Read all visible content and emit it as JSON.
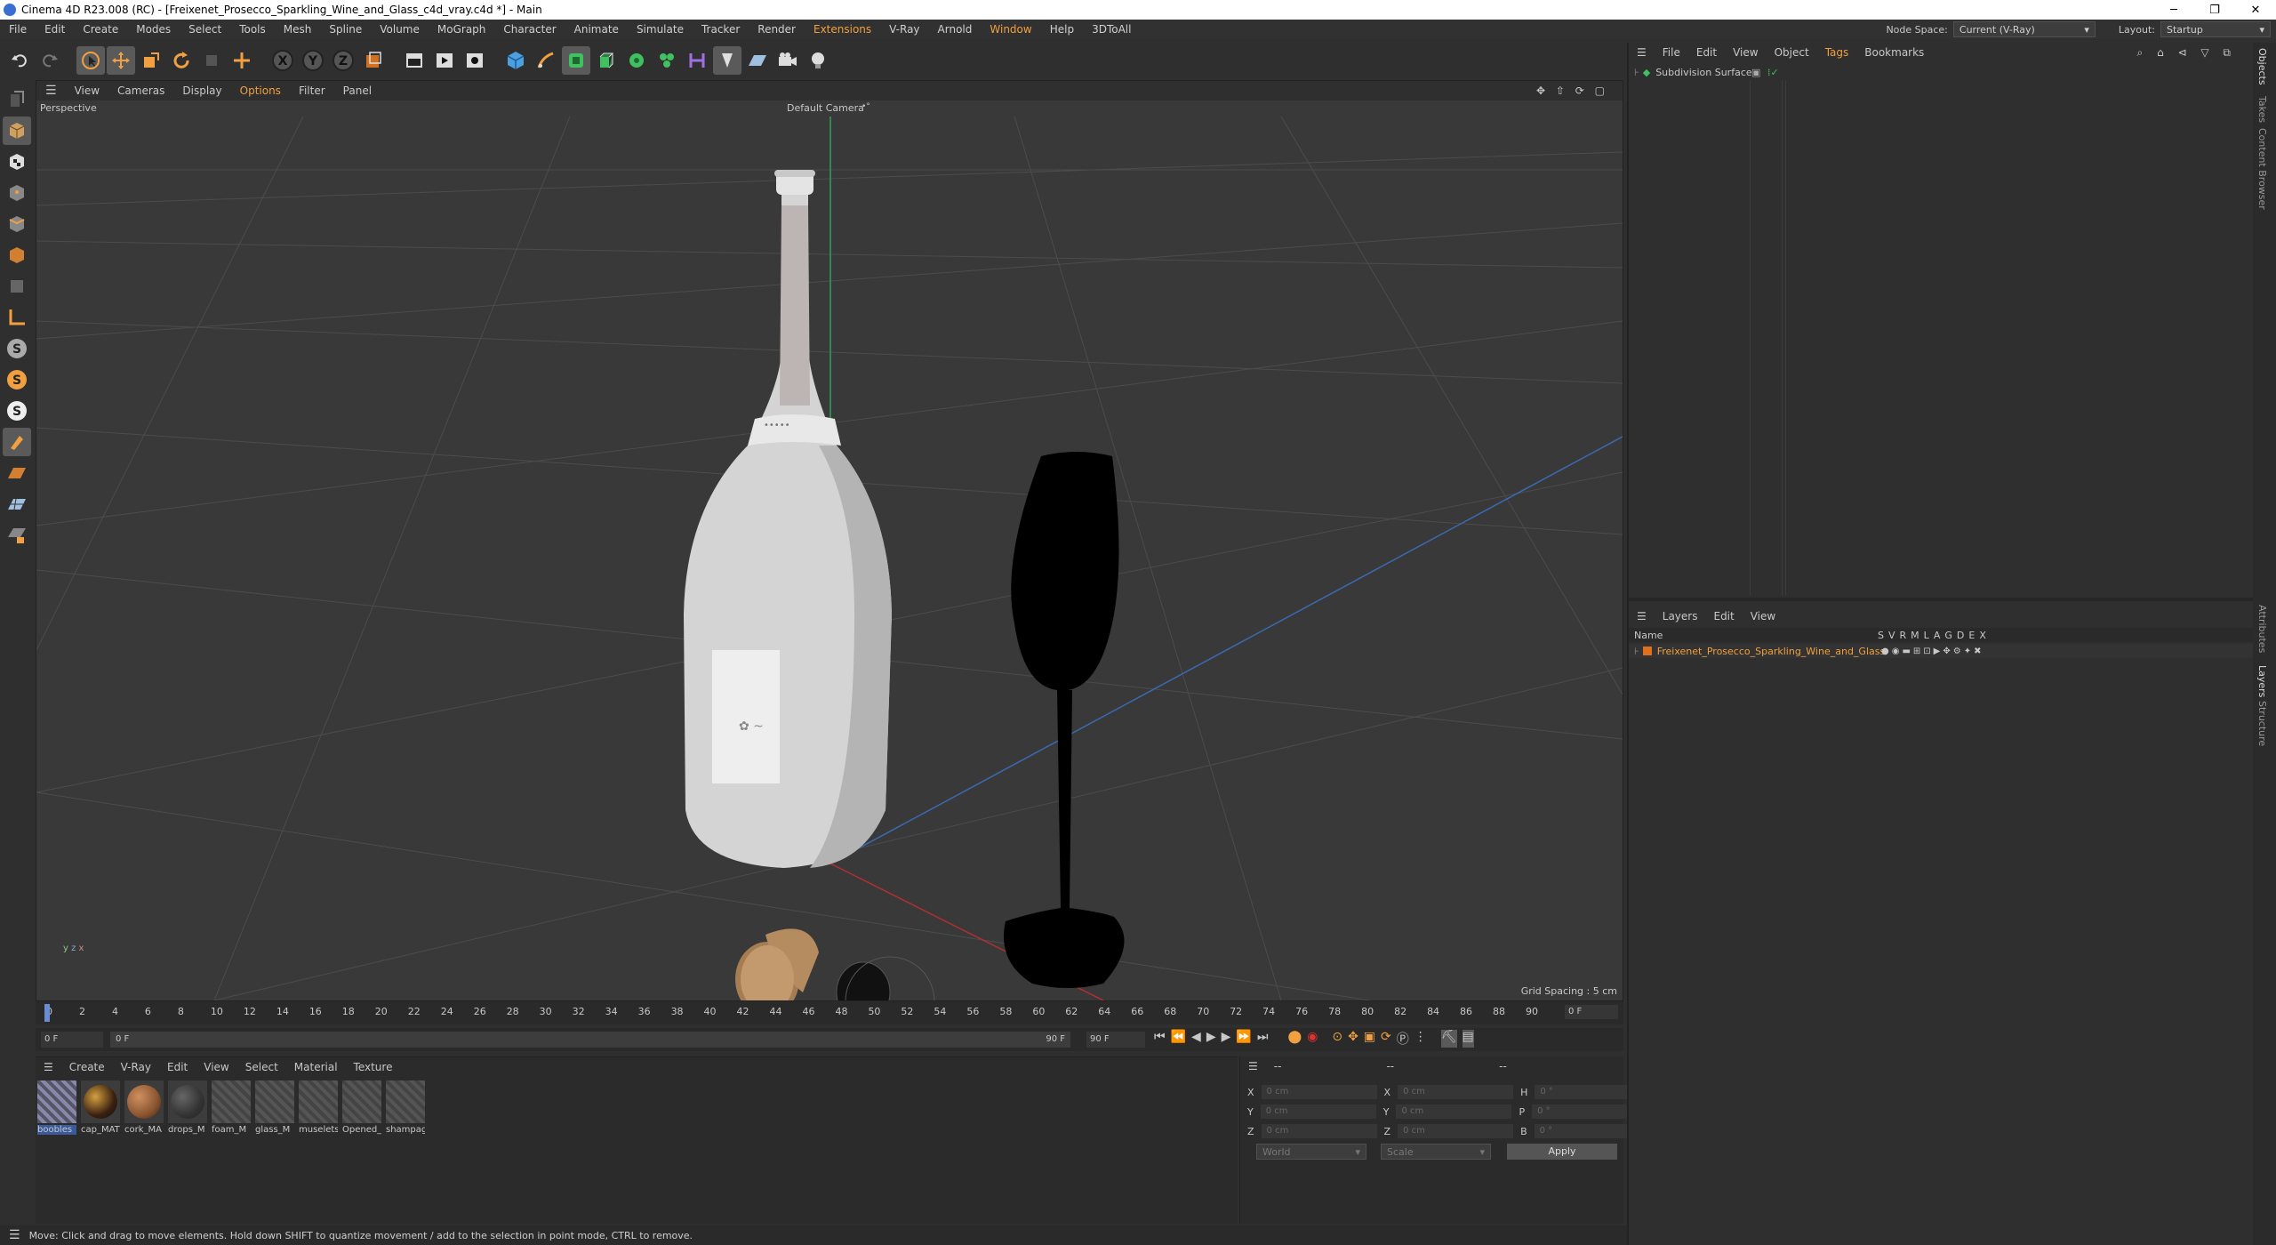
{
  "window": {
    "title": "Cinema 4D R23.008 (RC) - [Freixenet_Prosecco_Sparkling_Wine_and_Glass_c4d_vray.c4d *] - Main",
    "min": "─",
    "max": "❐",
    "close": "✕"
  },
  "menubar": {
    "items": [
      "File",
      "Edit",
      "Create",
      "Modes",
      "Select",
      "Tools",
      "Mesh",
      "Spline",
      "Volume",
      "MoGraph",
      "Character",
      "Animate",
      "Simulate",
      "Tracker",
      "Render",
      "Extensions",
      "V-Ray",
      "Arnold",
      "Window",
      "Help",
      "3DToAll"
    ],
    "node_space_label": "Node Space:",
    "node_space_value": "Current (V-Ray)",
    "layout_label": "Layout:",
    "layout_value": "Startup"
  },
  "viewport": {
    "menu": [
      "View",
      "Cameras",
      "Display",
      "Options",
      "Filter",
      "Panel"
    ],
    "view_name": "Perspective",
    "camera_name": "Default Camera",
    "grid_spacing": "Grid Spacing : 5 cm",
    "axis_y": "y",
    "axis_z": "z",
    "axis_x": "x"
  },
  "timeline": {
    "ticks": [
      "0",
      "2",
      "4",
      "6",
      "8",
      "10",
      "12",
      "14",
      "16",
      "18",
      "20",
      "22",
      "24",
      "26",
      "28",
      "30",
      "32",
      "34",
      "36",
      "38",
      "40",
      "42",
      "44",
      "46",
      "48",
      "50",
      "52",
      "54",
      "56",
      "58",
      "60",
      "62",
      "64",
      "66",
      "68",
      "70",
      "72",
      "74",
      "76",
      "78",
      "80",
      "82",
      "84",
      "86",
      "88",
      "90"
    ],
    "current_frame": "0 F"
  },
  "transport": {
    "start": "0 F",
    "range_start": "0 F",
    "range_end": "90 F",
    "end": "90 F"
  },
  "material_manager": {
    "menu": [
      "Create",
      "V-Ray",
      "Edit",
      "View",
      "Select",
      "Material",
      "Texture"
    ],
    "materials": [
      "boobles",
      "cap_MAT",
      "cork_MA",
      "drops_M",
      "foam_M",
      "glass_M",
      "muselets",
      "Opened_",
      "shampag"
    ]
  },
  "coordinates": {
    "header": "--",
    "header2": "--",
    "header3": "--",
    "rows": [
      {
        "a": "X",
        "av": "0 cm",
        "b": "X",
        "bv": "0 cm",
        "c": "H",
        "cv": "0 °"
      },
      {
        "a": "Y",
        "av": "0 cm",
        "b": "Y",
        "bv": "0 cm",
        "c": "P",
        "cv": "0 °"
      },
      {
        "a": "Z",
        "av": "0 cm",
        "b": "Z",
        "bv": "0 cm",
        "c": "B",
        "cv": "0 °"
      }
    ],
    "world": "World",
    "scale": "Scale",
    "apply": "Apply"
  },
  "status": "Move: Click and drag to move elements. Hold down SHIFT to quantize movement / add to the selection in point mode, CTRL to remove.",
  "objects_panel": {
    "menu": [
      "File",
      "Edit",
      "View",
      "Object",
      "Tags",
      "Bookmarks"
    ],
    "item": "Subdivision Surface"
  },
  "layers_panel": {
    "menu": [
      "Layers",
      "Edit",
      "View"
    ],
    "name_header": "Name",
    "flags": [
      "S",
      "V",
      "R",
      "M",
      "L",
      "A",
      "G",
      "D",
      "E",
      "X"
    ],
    "layer": "Freixenet_Prosecco_Sparkling_Wine_and_Glass"
  },
  "side_tabs": [
    "Objects",
    "Takes",
    "Content Browser",
    "Attributes",
    "Layers",
    "Structure"
  ],
  "colors": {
    "accent": "#f0a040",
    "layer_color": "#e07020",
    "selection": "#5a5a5a"
  }
}
